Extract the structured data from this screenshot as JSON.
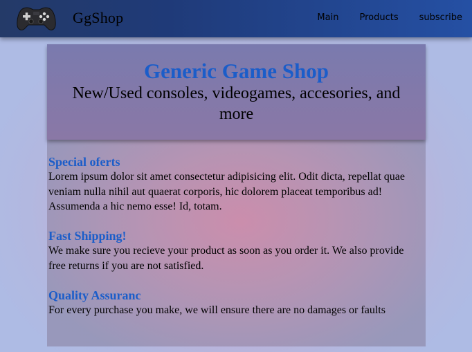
{
  "header": {
    "brand": "GgShop",
    "logo_icon": "gamepad-icon",
    "nav": [
      {
        "label": "Main"
      },
      {
        "label": "Products"
      },
      {
        "label": "subscribe"
      }
    ]
  },
  "hero": {
    "title": "Generic Game Shop",
    "subtitle": "New/Used consoles, videogames, accesories, and more"
  },
  "sections": [
    {
      "title": "Special oferts",
      "body": "Lorem ipsum dolor sit amet consectetur adipisicing elit. Odit dicta, repellat quae veniam nulla nihil aut quaerat corporis, hic dolorem placeat temporibus ad! Assumenda a hic nemo esse! Id, totam."
    },
    {
      "title": "Fast Shipping!",
      "body": "We make sure you recieve your product as soon as you order it. We also provide free returns if you are not satisfied."
    },
    {
      "title": "Quality Assuranc",
      "body": "For every purchase you make, we will ensure there are no damages or faults"
    }
  ],
  "colors": {
    "navbar": "#1f3a78",
    "accent_blue": "#1b5dc9",
    "hero_bg": "#7a7aae"
  }
}
